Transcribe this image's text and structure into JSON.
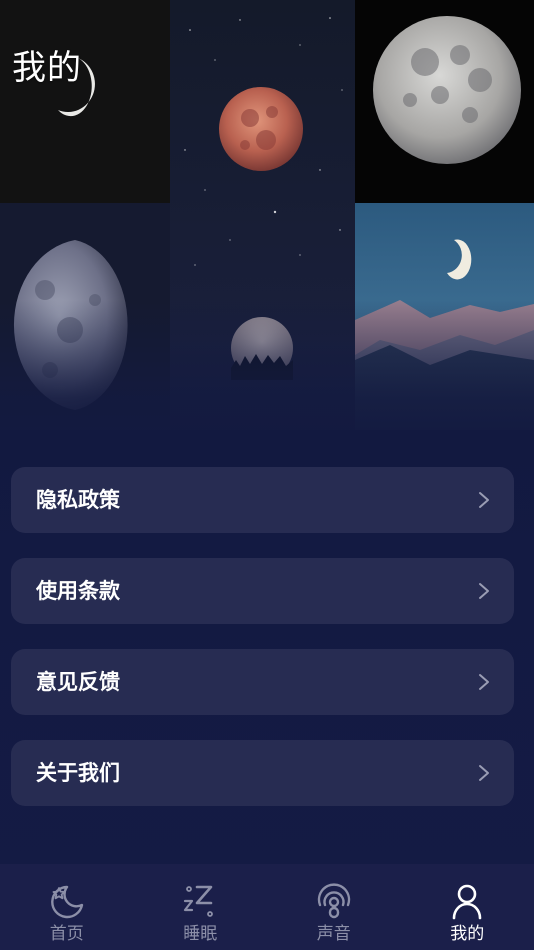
{
  "page": {
    "title": "我的"
  },
  "menu": {
    "items": [
      {
        "label": "隐私政策"
      },
      {
        "label": "使用条款"
      },
      {
        "label": "意见反馈"
      },
      {
        "label": "关于我们"
      }
    ]
  },
  "tabbar": {
    "active_index": 3,
    "tabs": [
      {
        "label": "首页",
        "icon": "moon-star-icon"
      },
      {
        "label": "睡眠",
        "icon": "sleep-zz-icon"
      },
      {
        "label": "声音",
        "icon": "podcast-icon"
      },
      {
        "label": "我的",
        "icon": "person-icon"
      }
    ]
  },
  "colors": {
    "background": "#131a40",
    "card": "#272c52",
    "tabbar": "#1b1f4a",
    "tab_inactive": "#8c8fa8",
    "tab_active": "#ffffff"
  }
}
